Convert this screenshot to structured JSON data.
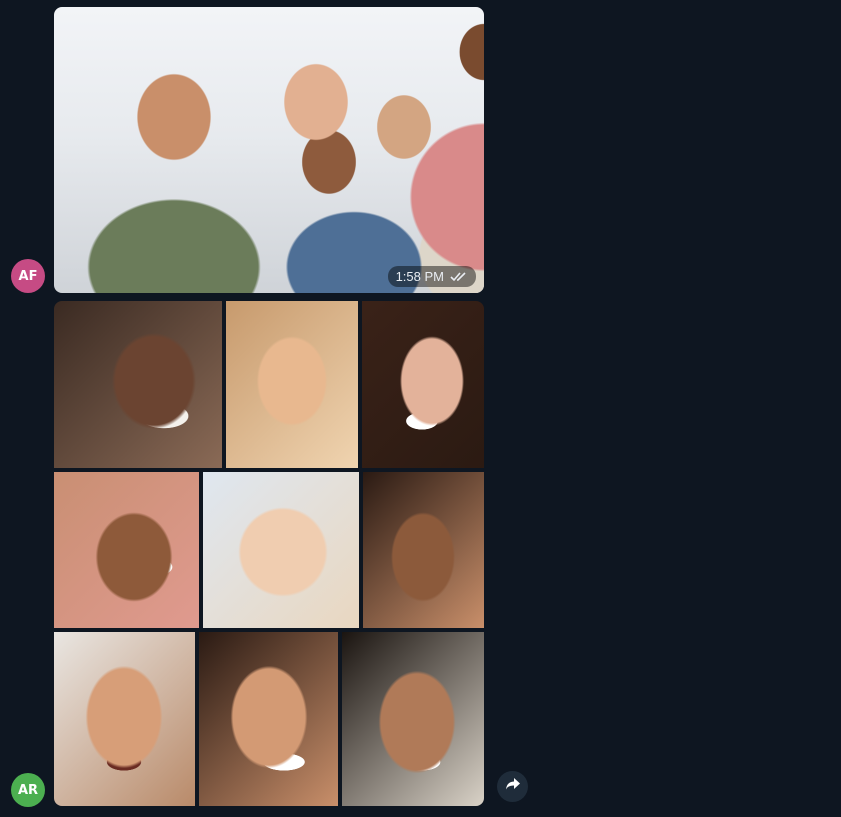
{
  "messages": [
    {
      "sender_initials": "AF",
      "avatar_color": "#c64b84",
      "time": "1:58 PM",
      "status_icon": "double-check-icon"
    },
    {
      "sender_initials": "AR",
      "avatar_color": "#4caf50",
      "album_photo_count": 9
    }
  ],
  "forward_icon": "forward-arrow-icon",
  "colors": {
    "background": "#0e1621",
    "badge_bg": "rgba(0,0,0,0.45)",
    "forward_button_bg": "#1f2c3a"
  }
}
